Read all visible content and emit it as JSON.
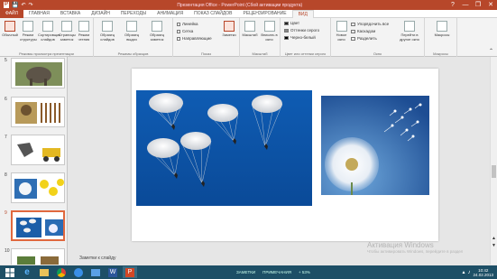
{
  "window": {
    "title": "Презентация Office - PowerPoint (Сбой активации продукта)",
    "controls": [
      "?",
      "—",
      "❐",
      "✕"
    ]
  },
  "tabs": [
    "ФАЙЛ",
    "ГЛАВНАЯ",
    "ВСТАВКА",
    "ДИЗАЙН",
    "ПЕРЕХОДЫ",
    "АНИМАЦИЯ",
    "ПОКАЗ СЛАЙДОВ",
    "РЕЦЕНЗИРОВАНИЕ",
    "ВИД"
  ],
  "active_tab": "ВИД",
  "ribbon": {
    "groups": {
      "presentation_views": "Режимы просмотра презентации",
      "master_views": "Режимы образцов",
      "show": "Показ",
      "zoom": "Масштаб",
      "color": "Цвет или оттенки серого",
      "window": "Окно",
      "macros": "Макросы"
    },
    "buttons": {
      "normal": "Обычный",
      "outline": "Режим структуры",
      "sorter": "Сортировщик слайдов",
      "notes_page": "Страницы заметок",
      "reading": "Режим чтения",
      "slide_master": "Образец слайдов",
      "handout_master": "Образец выдач",
      "notes_master": "Образец заметок",
      "zoom": "Масштаб",
      "fit": "Вписать в окно",
      "new_window": "Новое окно",
      "switch_windows": "Перейти в другое окно",
      "macros": "Макросы"
    },
    "checks": {
      "ruler": "Линейка",
      "grid": "Сетка",
      "guides": "Направляющие",
      "notes": "Заметки"
    },
    "color_options": {
      "color": "Цвет",
      "grayscale": "Оттенки серого",
      "bw": "Черно-белый"
    },
    "window_options": {
      "arrange": "Упорядочить все",
      "cascade": "Каскадом",
      "move_split": "Разделить"
    }
  },
  "slides": [
    {
      "num": "5"
    },
    {
      "num": "6"
    },
    {
      "num": "7"
    },
    {
      "num": "8"
    },
    {
      "num": "9"
    },
    {
      "num": "10"
    }
  ],
  "notes_placeholder": "Заметки к слайду",
  "watermark": {
    "line1": "Активация Windows",
    "line2": "Чтобы активировать Windows, перейдите в раздел"
  },
  "status": {
    "notes": "ЗАМЕТКИ",
    "comments": "ПРИМЕЧАНИЯ",
    "zoom": "+ 53%"
  },
  "taskbar": {
    "time": "10:42",
    "date": "24.02.2013"
  },
  "colors": {
    "accent": "#b7472a",
    "sky": "#1b5ea8",
    "taskbar": "#1d4f66"
  }
}
